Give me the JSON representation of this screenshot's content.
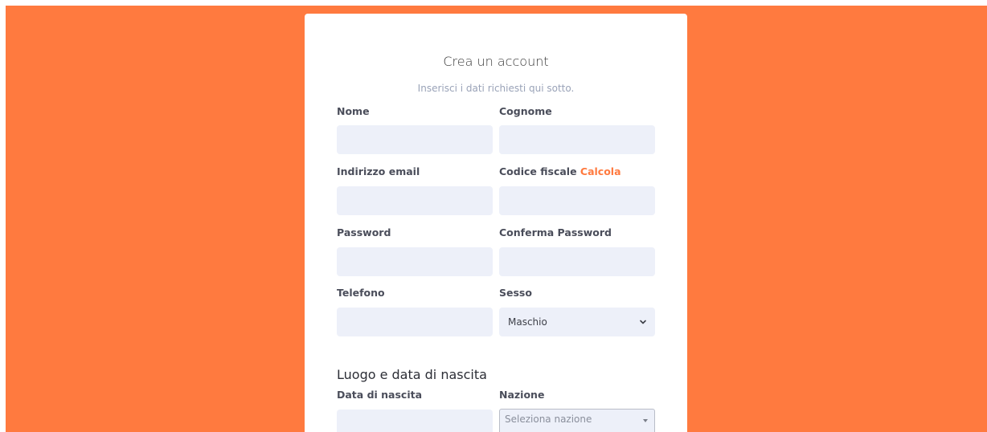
{
  "form": {
    "title": "Crea un account",
    "subtitle": "Inserisci i dati richiesti qui sotto.",
    "fields": {
      "nome": {
        "label": "Nome",
        "value": ""
      },
      "cognome": {
        "label": "Cognome",
        "value": ""
      },
      "email": {
        "label": "Indirizzo email",
        "value": ""
      },
      "codice_fiscale": {
        "label": "Codice fiscale",
        "link": "Calcola",
        "value": ""
      },
      "password": {
        "label": "Password",
        "value": ""
      },
      "conferma_password": {
        "label": "Conferma Password",
        "value": ""
      },
      "telefono": {
        "label": "Telefono",
        "value": ""
      },
      "sesso": {
        "label": "Sesso",
        "selected": "Maschio"
      }
    },
    "birth_section": {
      "title": "Luogo e data di nascita",
      "data_nascita": {
        "label": "Data di nascita",
        "value": ""
      },
      "nazione": {
        "label": "Nazione",
        "placeholder": "Seleziona nazione"
      }
    }
  },
  "colors": {
    "background": "#ff7a3f",
    "accent": "#ff7a3f",
    "input_bg": "#edf0f9"
  },
  "icons": {
    "sesso_select": "chevron-down-icon",
    "nazione_select": "caret-down-icon"
  }
}
